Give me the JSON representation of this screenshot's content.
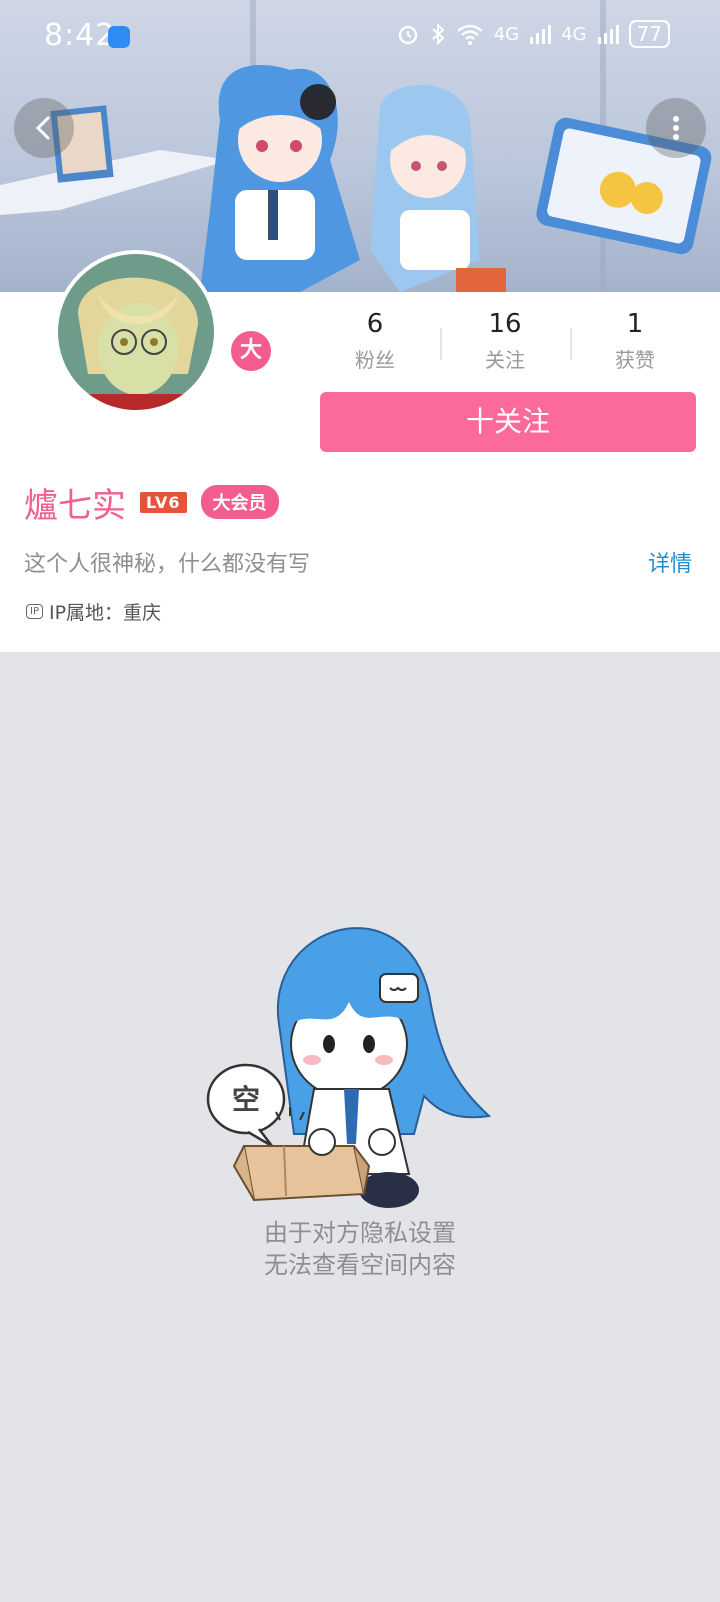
{
  "status_bar": {
    "time": "8:42",
    "network_1": "4G",
    "network_2": "4G",
    "battery": "77"
  },
  "profile": {
    "username": "爐七实",
    "level": "LV6",
    "vip_tag": "大会员",
    "vip_badge": "大",
    "bio": "这个人很神秘，什么都没有写",
    "details_link": "详情",
    "ip_icon_text": "IP",
    "ip_location": "IP属地：重庆",
    "follow_button": "十关注",
    "stats": [
      {
        "value": "6",
        "label": "粉丝"
      },
      {
        "value": "16",
        "label": "关注"
      },
      {
        "value": "1",
        "label": "获赞"
      }
    ]
  },
  "empty_state": {
    "bubble": "空",
    "line1": "由于对方隐私设置",
    "line2": "无法查看空间内容"
  },
  "colors": {
    "accent_pink": "#fb6a98",
    "link_blue": "#1f8fd1",
    "level_red": "#e7523a",
    "background": "#e3e4e8"
  }
}
